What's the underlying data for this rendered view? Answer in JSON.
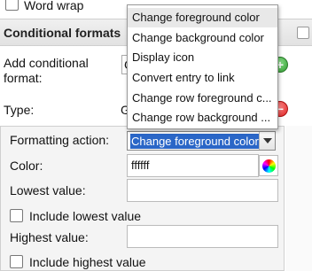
{
  "top": {
    "word_wrap_label": "Word wrap"
  },
  "section": {
    "title": "Conditional formats"
  },
  "add_conditional": {
    "label_line1": "Add conditional",
    "label_line2": "format:",
    "field_partial": "C"
  },
  "type": {
    "label": "Type:",
    "field_partial": "G"
  },
  "formatting_action": {
    "label": "Formatting action:",
    "selected": "Change foreground color",
    "options": [
      "Change foreground color",
      "Change background color",
      "Display icon",
      "Convert entry to link",
      "Change row foreground c...",
      "Change row background ..."
    ]
  },
  "color": {
    "label": "Color:",
    "value": "ffffff"
  },
  "lowest": {
    "label": "Lowest value:",
    "value": "",
    "include_label": "Include lowest value"
  },
  "highest": {
    "label": "Highest value:",
    "value": "",
    "include_label": "Include highest value"
  },
  "colors": {
    "accent": "#2a66c7",
    "add": "#3aa83a",
    "remove": "#dd2222"
  },
  "icons": {
    "add": "plus-icon",
    "remove": "minus-icon",
    "color_picker": "color-wheel-icon",
    "dropdown": "chevron-down-icon"
  }
}
